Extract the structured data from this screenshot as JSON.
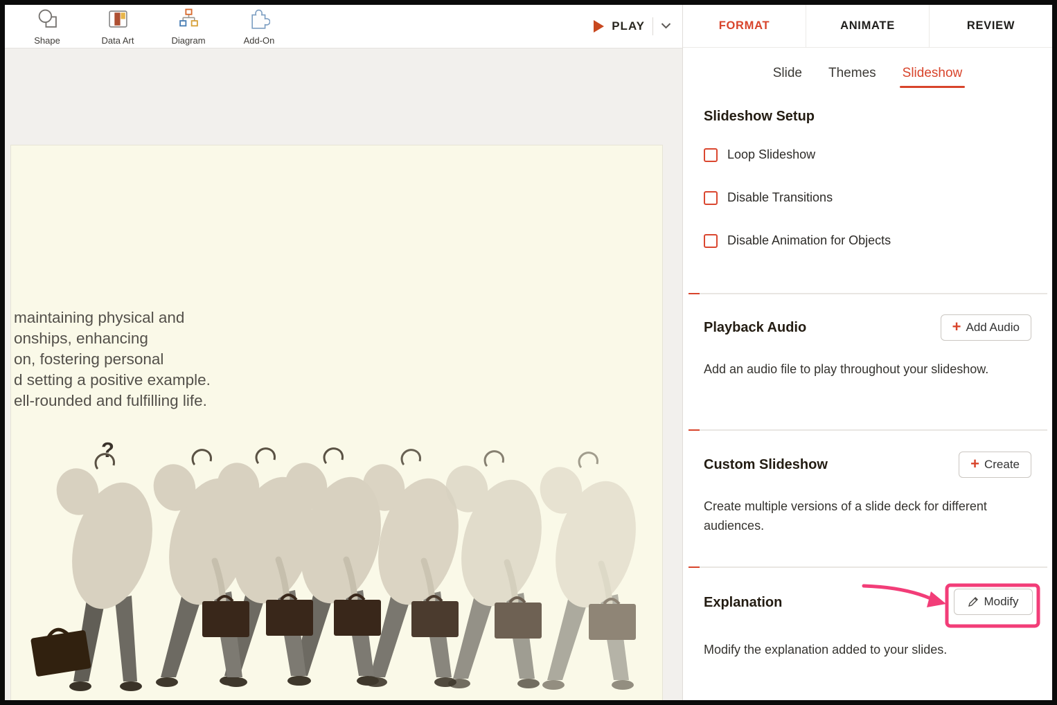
{
  "colors": {
    "accent": "#d8442b",
    "annotation": "#f23d78",
    "slide_bg": "#faf9e8"
  },
  "toolbar": {
    "items": [
      {
        "label": "Shape",
        "icon": "shape-icon"
      },
      {
        "label": "Data Art",
        "icon": "data-art-icon"
      },
      {
        "label": "Diagram",
        "icon": "diagram-icon"
      },
      {
        "label": "Add-On",
        "icon": "add-on-icon"
      }
    ],
    "play_label": "PLAY"
  },
  "panel": {
    "tabs": [
      {
        "label": "FORMAT",
        "active": true
      },
      {
        "label": "ANIMATE",
        "active": false
      },
      {
        "label": "REVIEW",
        "active": false
      }
    ],
    "subtabs": [
      {
        "label": "Slide",
        "active": false
      },
      {
        "label": "Themes",
        "active": false
      },
      {
        "label": "Slideshow",
        "active": true
      }
    ],
    "sections": {
      "setup": {
        "title": "Slideshow Setup",
        "options": [
          "Loop Slideshow",
          "Disable Transitions",
          "Disable Animation for Objects"
        ]
      },
      "playback_audio": {
        "title": "Playback Audio",
        "button_plus": "+",
        "button_label": "Add Audio",
        "description": "Add an audio file to play throughout your slideshow."
      },
      "custom_slideshow": {
        "title": "Custom Slideshow",
        "button_plus": "+",
        "button_label": "Create",
        "description": "Create multiple versions of a slide deck for different audiences."
      },
      "explanation": {
        "title": "Explanation",
        "button_label": "Modify",
        "description": "Modify the explanation added to your slides."
      }
    }
  },
  "slide": {
    "text_lines": [
      "maintaining physical and",
      "onships, enhancing",
      "on, fostering personal",
      "d setting a positive example.",
      "ell-rounded and fulfilling life."
    ],
    "question_mark": "?"
  }
}
